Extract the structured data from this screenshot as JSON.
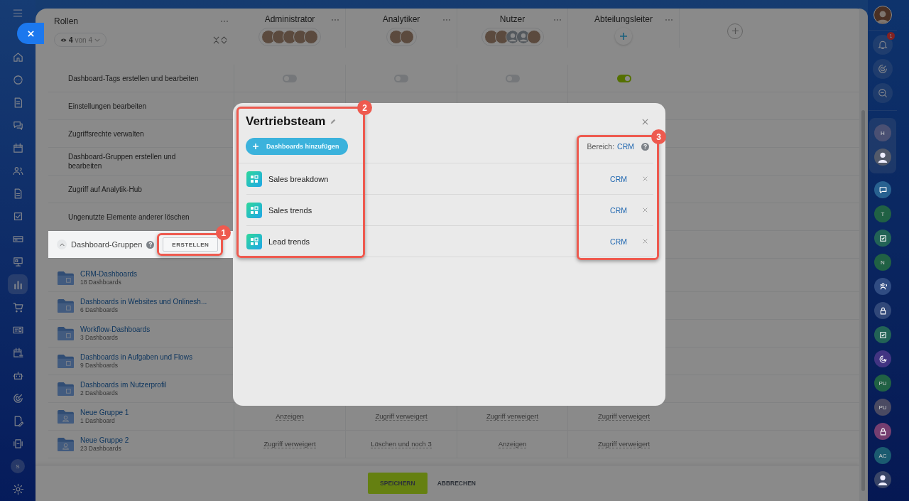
{
  "left_nav": {
    "items": [
      {
        "kind": "home",
        "selected": false
      },
      {
        "kind": "circle",
        "selected": false
      },
      {
        "kind": "document",
        "selected": false
      },
      {
        "kind": "chat",
        "selected": false
      },
      {
        "kind": "calendar",
        "selected": false
      },
      {
        "kind": "people",
        "selected": false
      },
      {
        "kind": "file",
        "selected": false
      },
      {
        "kind": "checkbox",
        "selected": false
      },
      {
        "kind": "card",
        "selected": false
      },
      {
        "kind": "board",
        "selected": false
      },
      {
        "kind": "bar-chart",
        "selected": true
      },
      {
        "kind": "cart",
        "selected": false
      },
      {
        "kind": "id-card",
        "selected": false
      },
      {
        "kind": "calendar-list",
        "selected": false
      },
      {
        "kind": "robot",
        "selected": false
      },
      {
        "kind": "target",
        "selected": false
      },
      {
        "kind": "pen-document",
        "selected": false
      },
      {
        "kind": "device",
        "selected": false
      }
    ],
    "user_initial": "S"
  },
  "roles": {
    "title": "Rollen",
    "filter": {
      "count": "4",
      "total": "von 4"
    },
    "columns": [
      {
        "name": "Administrator",
        "avatars": [
          {
            "kind": "photo"
          },
          {
            "kind": "photo"
          },
          {
            "kind": "photo"
          },
          {
            "kind": "photo"
          },
          {
            "kind": "photo"
          }
        ]
      },
      {
        "name": "Analytiker",
        "avatars": [
          {
            "kind": "photo"
          },
          {
            "kind": "photo"
          }
        ]
      },
      {
        "name": "Nutzer",
        "avatars": [
          {
            "kind": "photo"
          },
          {
            "kind": "photo"
          },
          {
            "kind": "silhouette"
          },
          {
            "kind": "silhouette"
          },
          {
            "kind": "photo"
          }
        ]
      },
      {
        "name": "Abteilungsleiter",
        "avatars": [
          {
            "kind": "add"
          }
        ]
      }
    ]
  },
  "permissions": [
    {
      "label": "Dashboard-Tags erstellen und bearbeiten",
      "toggles": [
        {
          "on": false
        },
        {
          "on": false
        },
        {
          "on": false
        },
        {
          "on": true
        }
      ]
    },
    {
      "label": "Einstellungen bearbeiten"
    },
    {
      "label": "Zugriffsrechte verwalten"
    },
    {
      "label": "Dashboard-Gruppen erstellen und bearbeiten"
    },
    {
      "label": "Zugriff auf Analytik-Hub"
    },
    {
      "label": "Ungenutzte Elemente anderer löschen"
    }
  ],
  "section": {
    "label": "Dashboard-Gruppen",
    "help": "?",
    "expanded": true,
    "button": "ERSTELLEN"
  },
  "groups": [
    {
      "name": "CRM-Dashboards",
      "count": "18 Dashboards",
      "kind": "system"
    },
    {
      "name": "Dashboards in Websites und Onlinesh...",
      "count": "6 Dashboards",
      "kind": "system"
    },
    {
      "name": "Workflow-Dashboards",
      "count": "3 Dashboards",
      "kind": "system"
    },
    {
      "name": "Dashboards in Aufgaben und Flows",
      "count": "9 Dashboards",
      "kind": "system"
    },
    {
      "name": "Dashboards im Nutzerprofil",
      "count": "2 Dashboards",
      "kind": "system"
    },
    {
      "name": "Neue Gruppe 1",
      "count": "1 Dashboard",
      "kind": "custom",
      "cells": [
        "Anzeigen",
        "Zugriff verweigert",
        "Zugriff verweigert",
        "Zugriff verweigert"
      ]
    },
    {
      "name": "Neue Gruppe 2",
      "count": "23 Dashboards",
      "kind": "custom",
      "cells": [
        "Zugriff verweigert",
        "Löschen und noch 3",
        "Anzeigen",
        "Zugriff verweigert"
      ]
    }
  ],
  "footer": {
    "save": "SPEICHERN",
    "cancel": "ABBRECHEN"
  },
  "dialog": {
    "title": "Vertriebsteam",
    "add_button": "Dashboards hinzufügen",
    "scope_label": "Bereich:",
    "scope_value": "CRM",
    "help": "?",
    "items": [
      {
        "name": "Sales breakdown",
        "scope": "CRM"
      },
      {
        "name": "Sales trends",
        "scope": "CRM"
      },
      {
        "name": "Lead trends",
        "scope": "CRM"
      }
    ]
  },
  "callouts": [
    {
      "number": "1"
    },
    {
      "number": "2"
    },
    {
      "number": "3"
    }
  ],
  "right_bar": {
    "tools": [
      {
        "kind": "bell",
        "badge": "1"
      },
      {
        "kind": "target"
      },
      {
        "kind": "search-chat"
      }
    ],
    "pinned": [
      {
        "kind": "initials",
        "text": "H",
        "color": "#4a5073"
      },
      {
        "kind": "avatar",
        "color": "#535a6a"
      }
    ],
    "chats": [
      {
        "kind": "chat",
        "color": "#286190"
      },
      {
        "kind": "initials",
        "text": "T",
        "color": "#206144"
      },
      {
        "kind": "check",
        "color": "#226356"
      },
      {
        "kind": "initials",
        "text": "N",
        "color": "#206144"
      },
      {
        "kind": "group",
        "color": "#304c82"
      },
      {
        "kind": "lock",
        "color": "#314879"
      },
      {
        "kind": "check",
        "color": "#226356"
      },
      {
        "kind": "at",
        "color": "#423482"
      },
      {
        "kind": "initials",
        "text": "PU",
        "color": "#206144"
      },
      {
        "kind": "initials",
        "text": "PU",
        "color": "#4a4a62"
      },
      {
        "kind": "lock",
        "color": "#753e70"
      },
      {
        "kind": "initials",
        "text": "AC",
        "color": "#1b5b70"
      },
      {
        "kind": "avatar",
        "color": "#394567"
      }
    ]
  }
}
